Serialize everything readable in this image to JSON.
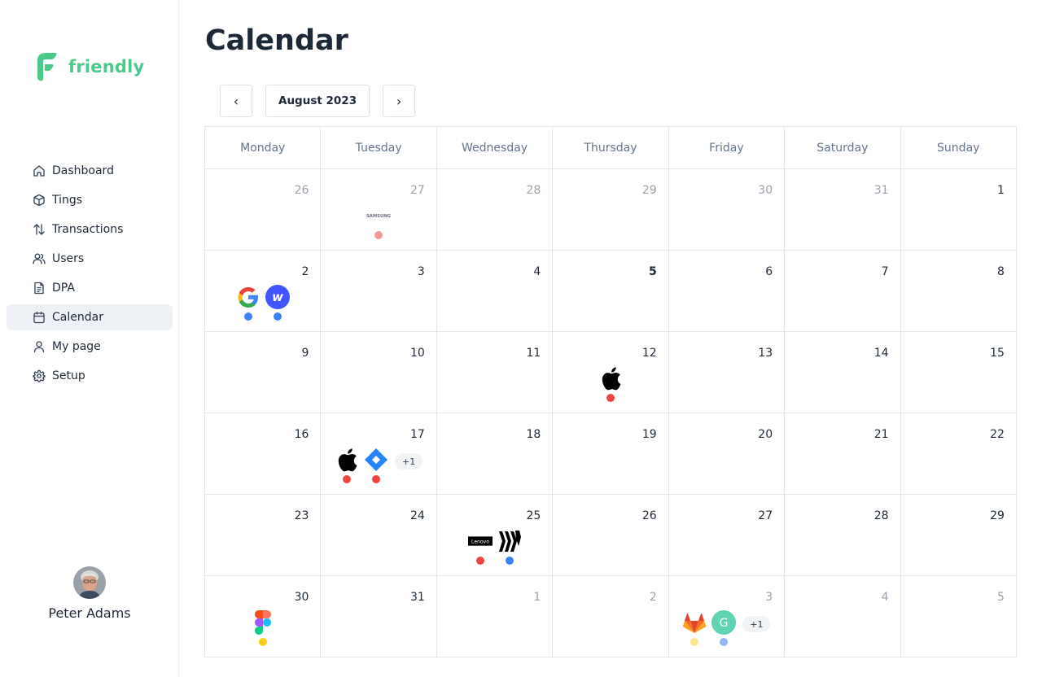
{
  "brand": {
    "name": "friendly",
    "color": "#4cc98a"
  },
  "page": {
    "title": "Calendar"
  },
  "sidebar": {
    "items": [
      {
        "label": "Dashboard",
        "icon": "home-icon"
      },
      {
        "label": "Tings",
        "icon": "box-icon"
      },
      {
        "label": "Transactions",
        "icon": "arrows-up-down-icon"
      },
      {
        "label": "Users",
        "icon": "users-icon"
      },
      {
        "label": "DPA",
        "icon": "document-icon"
      },
      {
        "label": "Calendar",
        "icon": "calendar-icon",
        "active": true
      },
      {
        "label": "My page",
        "icon": "user-icon"
      },
      {
        "label": "Setup",
        "icon": "gear-icon"
      }
    ]
  },
  "user": {
    "name": "Peter Adams"
  },
  "month_nav": {
    "prev": "‹",
    "current": "August 2023",
    "next": "›"
  },
  "calendar": {
    "weekdays": [
      "Monday",
      "Tuesday",
      "Wednesday",
      "Thursday",
      "Friday",
      "Saturday",
      "Sunday"
    ],
    "weeks": [
      [
        {
          "day": "26",
          "muted": true
        },
        {
          "day": "27",
          "muted": true,
          "events": [
            {
              "logo": "samsung",
              "dot": "#f29a9a"
            }
          ]
        },
        {
          "day": "28",
          "muted": true
        },
        {
          "day": "29",
          "muted": true
        },
        {
          "day": "30",
          "muted": true
        },
        {
          "day": "31",
          "muted": true
        },
        {
          "day": "1"
        }
      ],
      [
        {
          "day": "2",
          "events": [
            {
              "logo": "google",
              "dot": "#3b82f6"
            },
            {
              "logo": "webflow",
              "dot": "#3b82f6"
            }
          ]
        },
        {
          "day": "3"
        },
        {
          "day": "4"
        },
        {
          "day": "5",
          "bold": true
        },
        {
          "day": "6"
        },
        {
          "day": "7"
        },
        {
          "day": "8"
        }
      ],
      [
        {
          "day": "9"
        },
        {
          "day": "10"
        },
        {
          "day": "11"
        },
        {
          "day": "12",
          "events": [
            {
              "logo": "apple",
              "dot": "#ef4444"
            }
          ]
        },
        {
          "day": "13"
        },
        {
          "day": "14"
        },
        {
          "day": "15"
        }
      ],
      [
        {
          "day": "16"
        },
        {
          "day": "17",
          "events": [
            {
              "logo": "apple",
              "dot": "#ef4444"
            },
            {
              "logo": "jira",
              "dot": "#ef4444"
            }
          ],
          "more": "+1"
        },
        {
          "day": "18"
        },
        {
          "day": "19"
        },
        {
          "day": "20"
        },
        {
          "day": "21"
        },
        {
          "day": "22"
        }
      ],
      [
        {
          "day": "23"
        },
        {
          "day": "24"
        },
        {
          "day": "25",
          "events": [
            {
              "logo": "lenovo",
              "dot": "#ef4444"
            },
            {
              "logo": "miro",
              "dot": "#3b82f6"
            }
          ]
        },
        {
          "day": "26"
        },
        {
          "day": "27"
        },
        {
          "day": "28"
        },
        {
          "day": "29"
        }
      ],
      [
        {
          "day": "30",
          "events": [
            {
              "logo": "figma",
              "dot": "#facc15"
            }
          ]
        },
        {
          "day": "31"
        },
        {
          "day": "1",
          "muted": true
        },
        {
          "day": "2",
          "muted": true
        },
        {
          "day": "3",
          "muted": true,
          "events": [
            {
              "logo": "gitlab",
              "dot": "#fde68a"
            },
            {
              "logo": "grammarly",
              "dot": "#93b4f5"
            }
          ],
          "more": "+1"
        },
        {
          "day": "4",
          "muted": true
        },
        {
          "day": "5",
          "muted": true
        }
      ]
    ]
  },
  "logo_text": {
    "samsung": "SAMSUNG",
    "lenovo": "Lenovo",
    "webflow": "w",
    "grammarly": "G"
  }
}
